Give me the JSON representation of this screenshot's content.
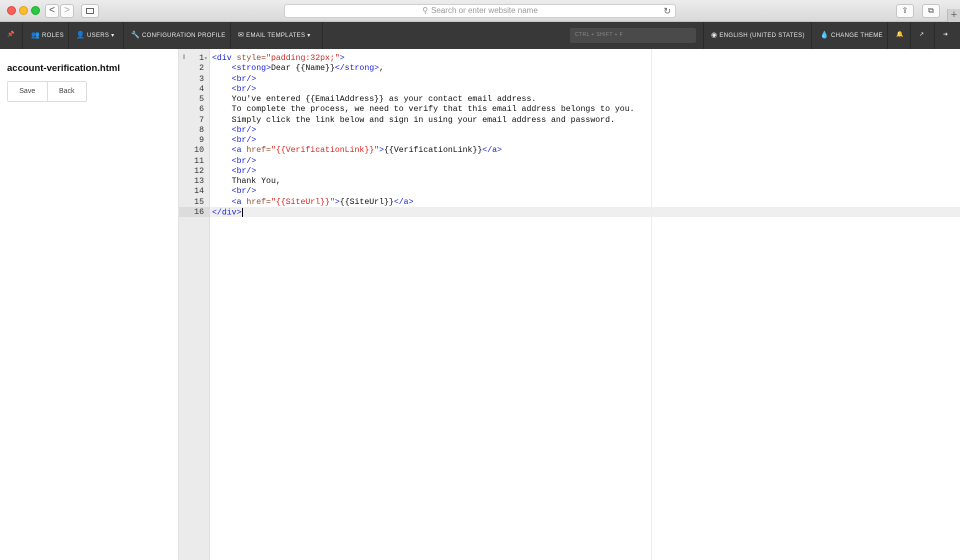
{
  "browser": {
    "address_placeholder": "Search or enter website name",
    "back_glyph": "<",
    "forward_glyph": ">",
    "reload_glyph": "↻",
    "share_glyph": "⇪",
    "tabs_glyph": "⧉",
    "new_tab_glyph": "+"
  },
  "nav": {
    "roles": "ROLES",
    "users": "USERS",
    "configuration_profile": "CONFIGURATION PROFILE",
    "email_templates": "EMAIL TEMPLATES",
    "search_placeholder": "CTRL + SHIFT + F",
    "language": "ENGLISH (UNITED STATES)",
    "change_theme": "CHANGE THEME",
    "pin_glyph": "📌",
    "roles_glyph": "👥",
    "users_glyph": "👤",
    "config_glyph": "🔧",
    "email_glyph": "✉",
    "caret_glyph": "▾",
    "globe_glyph": "◉",
    "theme_glyph": "💧",
    "bell_glyph": "🔔",
    "external_glyph": "↗",
    "logout_glyph": "➜"
  },
  "panel": {
    "filename": "account-verification.html",
    "save": "Save",
    "back": "Back"
  },
  "editor": {
    "marker": "‖",
    "fold_glyph": "▾",
    "active_line": 16,
    "lines": [
      {
        "n": "1",
        "code": "<div style=\"padding:32px;\">"
      },
      {
        "n": "2",
        "code": "    <strong>Dear {{Name}}</strong>,"
      },
      {
        "n": "3",
        "code": "    <br/>"
      },
      {
        "n": "4",
        "code": "    <br/>"
      },
      {
        "n": "5",
        "code": "    You've entered {{EmailAddress}} as your contact email address."
      },
      {
        "n": "6",
        "code": "    To complete the process, we need to verify that this email address belongs to you."
      },
      {
        "n": "7",
        "code": "    Simply click the link below and sign in using your email address and password."
      },
      {
        "n": "8",
        "code": "    <br/>"
      },
      {
        "n": "9",
        "code": "    <br/>"
      },
      {
        "n": "10",
        "code": "    <a href=\"{{VerificationLink}}\">{{VerificationLink}}</a>"
      },
      {
        "n": "11",
        "code": "    <br/>"
      },
      {
        "n": "12",
        "code": "    <br/>"
      },
      {
        "n": "13",
        "code": "    Thank You,"
      },
      {
        "n": "14",
        "code": "    <br/>"
      },
      {
        "n": "15",
        "code": "    <a href=\"{{SiteUrl}}\">{{SiteUrl}}</a>"
      },
      {
        "n": "16",
        "code": "</div>"
      }
    ]
  }
}
